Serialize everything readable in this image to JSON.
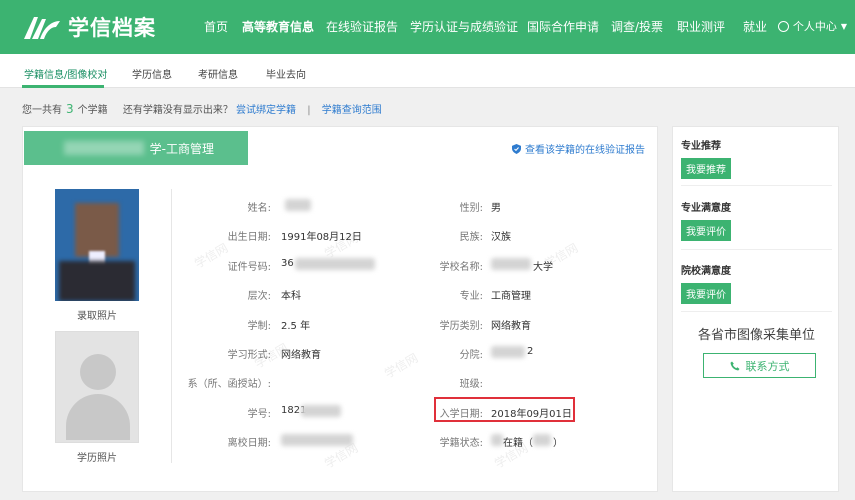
{
  "header": {
    "logo_text": "学信档案",
    "nav": [
      "首页",
      "高等教育信息",
      "在线验证报告",
      "学历认证与成绩验证",
      "国际合作申请",
      "调查/投票",
      "职业测评",
      "就业"
    ],
    "user_center": "个人中心"
  },
  "subnav": [
    "学籍信息/图像校对",
    "学历信息",
    "考研信息",
    "毕业去向"
  ],
  "infoline": {
    "prefix": "您一共有",
    "count": "3",
    "suffix": "个学籍",
    "question": "还有学籍没有显示出来？",
    "link1": "尝试绑定学籍",
    "sep": "|",
    "link2": "学籍查询范围"
  },
  "card": {
    "tab_label": "学-工商管理",
    "verify_link": "查看该学籍的在线验证报告",
    "photo1_caption": "录取照片",
    "photo2_caption": "学历照片",
    "fields_left": [
      {
        "label": "姓名:",
        "value": ""
      },
      {
        "label": "出生日期:",
        "value": "1991年08月12日"
      },
      {
        "label": "证件号码:",
        "value": "36"
      },
      {
        "label": "层次:",
        "value": "本科"
      },
      {
        "label": "学制:",
        "value": "2.5 年"
      },
      {
        "label": "学习形式:",
        "value": "网络教育"
      },
      {
        "label": "系（所、函授站）:",
        "value": ""
      },
      {
        "label": "学号:",
        "value": "1821"
      },
      {
        "label": "离校日期:",
        "value": ""
      }
    ],
    "fields_right": [
      {
        "label": "性别:",
        "value": "男"
      },
      {
        "label": "民族:",
        "value": "汉族"
      },
      {
        "label": "学校名称:",
        "value": "大学"
      },
      {
        "label": "专业:",
        "value": "工商管理"
      },
      {
        "label": "学历类别:",
        "value": "网络教育"
      },
      {
        "label": "分院:",
        "value": "2"
      },
      {
        "label": "班级:",
        "value": ""
      },
      {
        "label": "入学日期:",
        "value": "2018年09月01日"
      },
      {
        "label": "学籍状态:",
        "value": "在籍（"
      }
    ],
    "state_close": "）"
  },
  "side": {
    "s1_title": "专业推荐",
    "s1_btn": "我要推荐",
    "s2_title": "专业满意度",
    "s2_btn": "我要评价",
    "s3_title": "院校满意度",
    "s3_btn": "我要评价",
    "photo_collect": "各省市图像采集单位",
    "contact": "联系方式"
  },
  "watermark": "学信网",
  "colors": {
    "brand": "#3cb371",
    "link": "#2f7ccf",
    "highlight": "#e0303a"
  }
}
